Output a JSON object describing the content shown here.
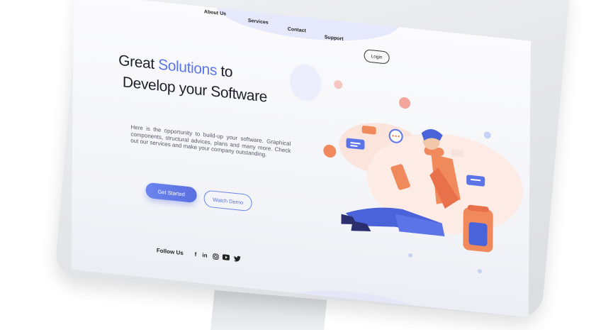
{
  "nav": {
    "about": "About Us",
    "services": "Services",
    "contact": "Contact",
    "support": "Support",
    "login": "Login"
  },
  "hero": {
    "title_part1": "Great ",
    "title_accent": "Solutions",
    "title_part2": " to",
    "title_line2": "Develop your Software",
    "description": "Here is the opportunity to build-up your software. Graphical components, structural advices, plans and many more. Check out our services and make your company outstanding.",
    "cta_primary": "Get Started",
    "cta_secondary": "Watch Demo"
  },
  "footer": {
    "follow_label": "Follow Us",
    "social": [
      "facebook-icon",
      "linkedin-icon",
      "instagram-icon",
      "youtube-icon",
      "twitter-icon"
    ]
  },
  "colors": {
    "accent": "#5b74e8",
    "illustration_orange": "#f08a5d",
    "illustration_blue": "#4a63d8"
  }
}
